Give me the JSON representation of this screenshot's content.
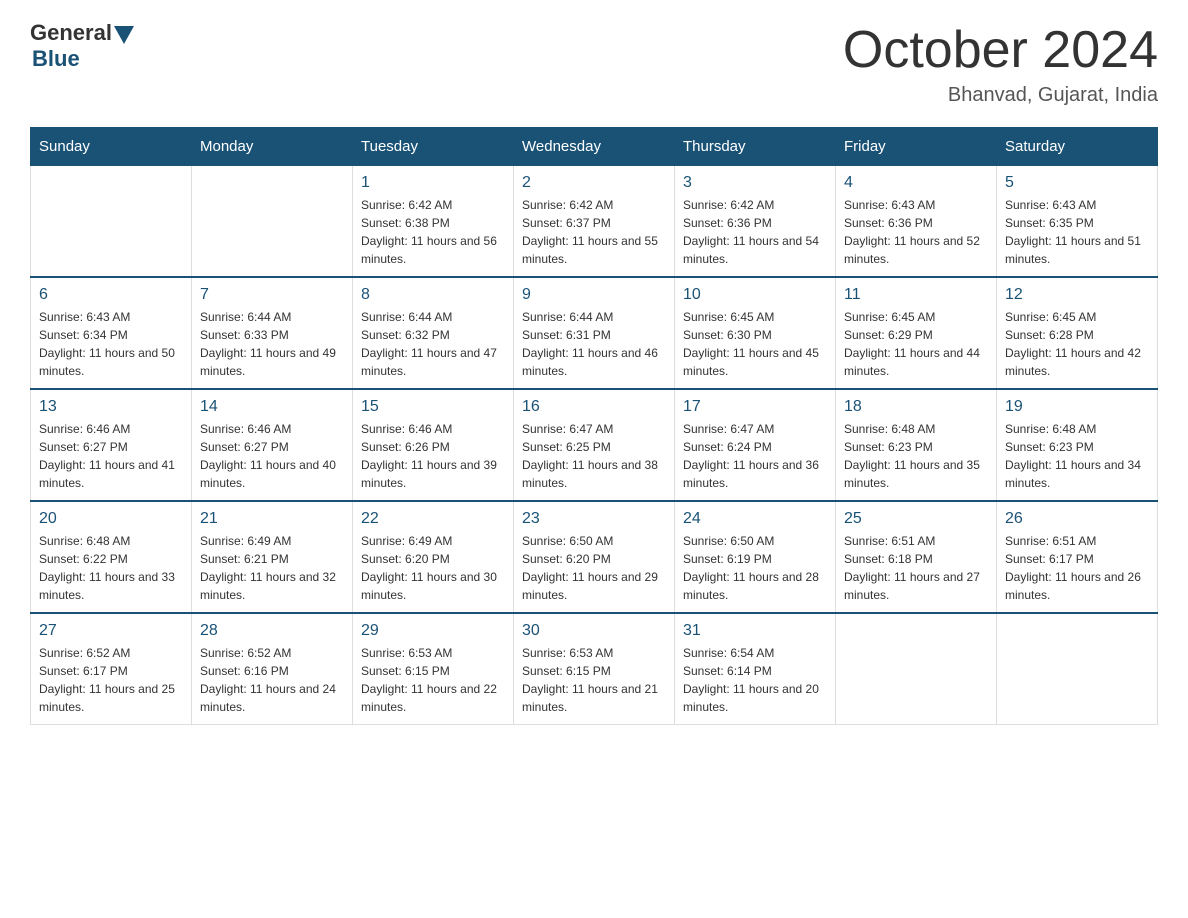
{
  "logo": {
    "general": "General",
    "blue": "Blue"
  },
  "title": {
    "month_year": "October 2024",
    "location": "Bhanvad, Gujarat, India"
  },
  "header_days": [
    "Sunday",
    "Monday",
    "Tuesday",
    "Wednesday",
    "Thursday",
    "Friday",
    "Saturday"
  ],
  "weeks": [
    [
      {
        "day": "",
        "sunrise": "",
        "sunset": "",
        "daylight": ""
      },
      {
        "day": "",
        "sunrise": "",
        "sunset": "",
        "daylight": ""
      },
      {
        "day": "1",
        "sunrise": "Sunrise: 6:42 AM",
        "sunset": "Sunset: 6:38 PM",
        "daylight": "Daylight: 11 hours and 56 minutes."
      },
      {
        "day": "2",
        "sunrise": "Sunrise: 6:42 AM",
        "sunset": "Sunset: 6:37 PM",
        "daylight": "Daylight: 11 hours and 55 minutes."
      },
      {
        "day": "3",
        "sunrise": "Sunrise: 6:42 AM",
        "sunset": "Sunset: 6:36 PM",
        "daylight": "Daylight: 11 hours and 54 minutes."
      },
      {
        "day": "4",
        "sunrise": "Sunrise: 6:43 AM",
        "sunset": "Sunset: 6:36 PM",
        "daylight": "Daylight: 11 hours and 52 minutes."
      },
      {
        "day": "5",
        "sunrise": "Sunrise: 6:43 AM",
        "sunset": "Sunset: 6:35 PM",
        "daylight": "Daylight: 11 hours and 51 minutes."
      }
    ],
    [
      {
        "day": "6",
        "sunrise": "Sunrise: 6:43 AM",
        "sunset": "Sunset: 6:34 PM",
        "daylight": "Daylight: 11 hours and 50 minutes."
      },
      {
        "day": "7",
        "sunrise": "Sunrise: 6:44 AM",
        "sunset": "Sunset: 6:33 PM",
        "daylight": "Daylight: 11 hours and 49 minutes."
      },
      {
        "day": "8",
        "sunrise": "Sunrise: 6:44 AM",
        "sunset": "Sunset: 6:32 PM",
        "daylight": "Daylight: 11 hours and 47 minutes."
      },
      {
        "day": "9",
        "sunrise": "Sunrise: 6:44 AM",
        "sunset": "Sunset: 6:31 PM",
        "daylight": "Daylight: 11 hours and 46 minutes."
      },
      {
        "day": "10",
        "sunrise": "Sunrise: 6:45 AM",
        "sunset": "Sunset: 6:30 PM",
        "daylight": "Daylight: 11 hours and 45 minutes."
      },
      {
        "day": "11",
        "sunrise": "Sunrise: 6:45 AM",
        "sunset": "Sunset: 6:29 PM",
        "daylight": "Daylight: 11 hours and 44 minutes."
      },
      {
        "day": "12",
        "sunrise": "Sunrise: 6:45 AM",
        "sunset": "Sunset: 6:28 PM",
        "daylight": "Daylight: 11 hours and 42 minutes."
      }
    ],
    [
      {
        "day": "13",
        "sunrise": "Sunrise: 6:46 AM",
        "sunset": "Sunset: 6:27 PM",
        "daylight": "Daylight: 11 hours and 41 minutes."
      },
      {
        "day": "14",
        "sunrise": "Sunrise: 6:46 AM",
        "sunset": "Sunset: 6:27 PM",
        "daylight": "Daylight: 11 hours and 40 minutes."
      },
      {
        "day": "15",
        "sunrise": "Sunrise: 6:46 AM",
        "sunset": "Sunset: 6:26 PM",
        "daylight": "Daylight: 11 hours and 39 minutes."
      },
      {
        "day": "16",
        "sunrise": "Sunrise: 6:47 AM",
        "sunset": "Sunset: 6:25 PM",
        "daylight": "Daylight: 11 hours and 38 minutes."
      },
      {
        "day": "17",
        "sunrise": "Sunrise: 6:47 AM",
        "sunset": "Sunset: 6:24 PM",
        "daylight": "Daylight: 11 hours and 36 minutes."
      },
      {
        "day": "18",
        "sunrise": "Sunrise: 6:48 AM",
        "sunset": "Sunset: 6:23 PM",
        "daylight": "Daylight: 11 hours and 35 minutes."
      },
      {
        "day": "19",
        "sunrise": "Sunrise: 6:48 AM",
        "sunset": "Sunset: 6:23 PM",
        "daylight": "Daylight: 11 hours and 34 minutes."
      }
    ],
    [
      {
        "day": "20",
        "sunrise": "Sunrise: 6:48 AM",
        "sunset": "Sunset: 6:22 PM",
        "daylight": "Daylight: 11 hours and 33 minutes."
      },
      {
        "day": "21",
        "sunrise": "Sunrise: 6:49 AM",
        "sunset": "Sunset: 6:21 PM",
        "daylight": "Daylight: 11 hours and 32 minutes."
      },
      {
        "day": "22",
        "sunrise": "Sunrise: 6:49 AM",
        "sunset": "Sunset: 6:20 PM",
        "daylight": "Daylight: 11 hours and 30 minutes."
      },
      {
        "day": "23",
        "sunrise": "Sunrise: 6:50 AM",
        "sunset": "Sunset: 6:20 PM",
        "daylight": "Daylight: 11 hours and 29 minutes."
      },
      {
        "day": "24",
        "sunrise": "Sunrise: 6:50 AM",
        "sunset": "Sunset: 6:19 PM",
        "daylight": "Daylight: 11 hours and 28 minutes."
      },
      {
        "day": "25",
        "sunrise": "Sunrise: 6:51 AM",
        "sunset": "Sunset: 6:18 PM",
        "daylight": "Daylight: 11 hours and 27 minutes."
      },
      {
        "day": "26",
        "sunrise": "Sunrise: 6:51 AM",
        "sunset": "Sunset: 6:17 PM",
        "daylight": "Daylight: 11 hours and 26 minutes."
      }
    ],
    [
      {
        "day": "27",
        "sunrise": "Sunrise: 6:52 AM",
        "sunset": "Sunset: 6:17 PM",
        "daylight": "Daylight: 11 hours and 25 minutes."
      },
      {
        "day": "28",
        "sunrise": "Sunrise: 6:52 AM",
        "sunset": "Sunset: 6:16 PM",
        "daylight": "Daylight: 11 hours and 24 minutes."
      },
      {
        "day": "29",
        "sunrise": "Sunrise: 6:53 AM",
        "sunset": "Sunset: 6:15 PM",
        "daylight": "Daylight: 11 hours and 22 minutes."
      },
      {
        "day": "30",
        "sunrise": "Sunrise: 6:53 AM",
        "sunset": "Sunset: 6:15 PM",
        "daylight": "Daylight: 11 hours and 21 minutes."
      },
      {
        "day": "31",
        "sunrise": "Sunrise: 6:54 AM",
        "sunset": "Sunset: 6:14 PM",
        "daylight": "Daylight: 11 hours and 20 minutes."
      },
      {
        "day": "",
        "sunrise": "",
        "sunset": "",
        "daylight": ""
      },
      {
        "day": "",
        "sunrise": "",
        "sunset": "",
        "daylight": ""
      }
    ]
  ]
}
